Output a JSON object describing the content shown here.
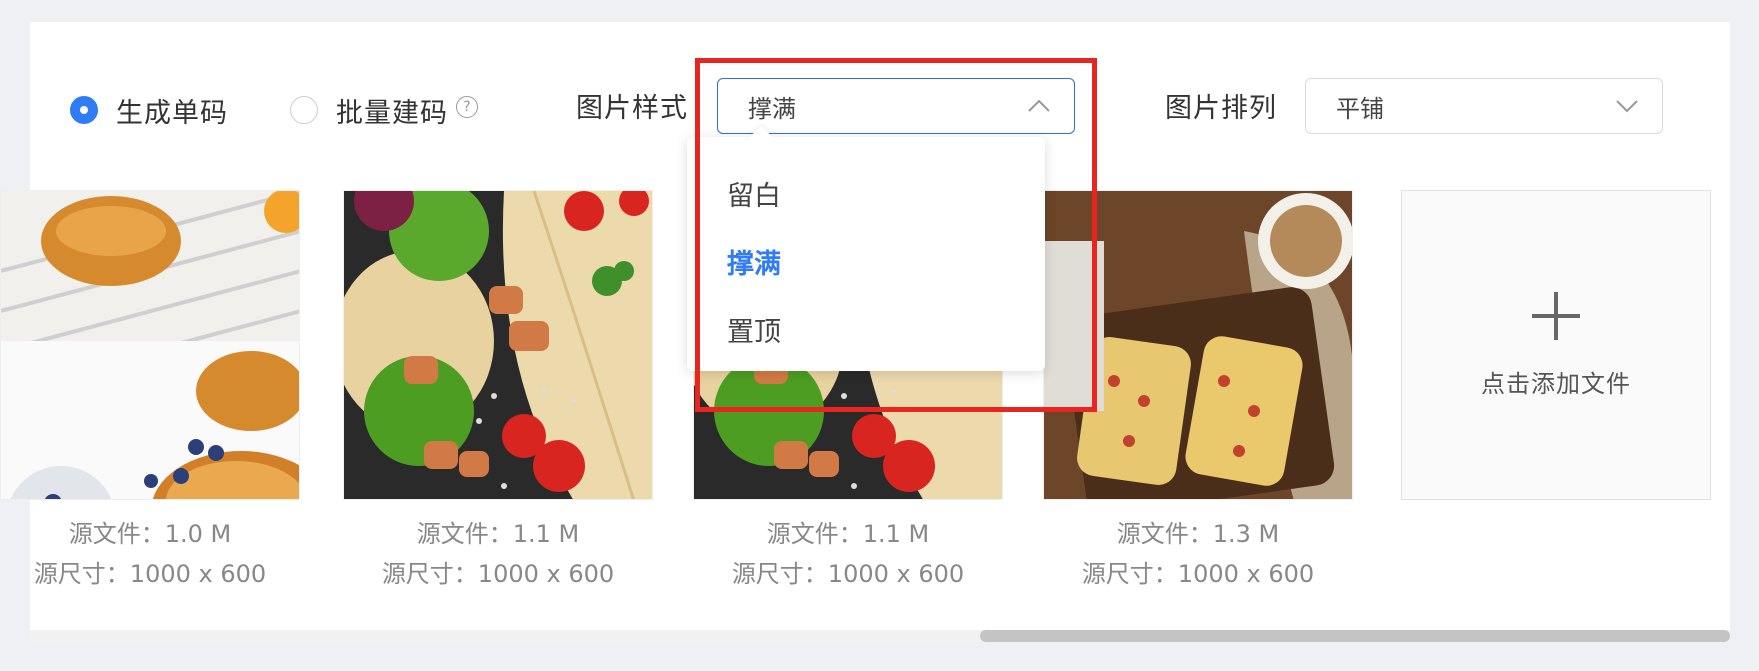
{
  "mode": {
    "single_label": "生成单码",
    "batch_label": "批量建码",
    "help_glyph": "?"
  },
  "style_field": {
    "label": "图片样式",
    "value": "撑满",
    "options": [
      "留白",
      "撑满",
      "置顶"
    ]
  },
  "layout_field": {
    "label": "图片排列",
    "value": "平铺"
  },
  "images": [
    {
      "source_file": "源文件：1.0 M",
      "source_size": "源尺寸：1000 x 600"
    },
    {
      "source_file": "源文件：1.1 M",
      "source_size": "源尺寸：1000 x 600"
    },
    {
      "source_file": "源文件：1.1 M",
      "source_size": "源尺寸：1000 x 600"
    },
    {
      "source_file": "源文件：1.3 M",
      "source_size": "源尺寸：1000 x 600"
    }
  ],
  "upload": {
    "label": "点击添加文件"
  },
  "colors": {
    "accent": "#2f7cf6",
    "highlight": "#e8261f"
  }
}
